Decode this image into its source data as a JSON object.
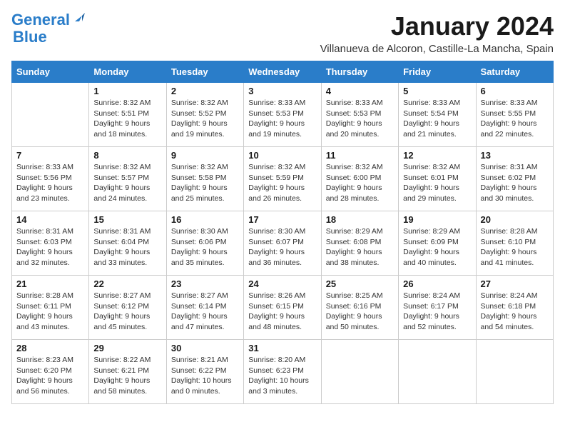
{
  "header": {
    "logo_line1": "General",
    "logo_line2": "Blue",
    "month": "January 2024",
    "location": "Villanueva de Alcoron, Castille-La Mancha, Spain"
  },
  "weekdays": [
    "Sunday",
    "Monday",
    "Tuesday",
    "Wednesday",
    "Thursday",
    "Friday",
    "Saturday"
  ],
  "weeks": [
    [
      {
        "day": "",
        "sunrise": "",
        "sunset": "",
        "daylight": ""
      },
      {
        "day": "1",
        "sunrise": "Sunrise: 8:32 AM",
        "sunset": "Sunset: 5:51 PM",
        "daylight": "Daylight: 9 hours and 18 minutes."
      },
      {
        "day": "2",
        "sunrise": "Sunrise: 8:32 AM",
        "sunset": "Sunset: 5:52 PM",
        "daylight": "Daylight: 9 hours and 19 minutes."
      },
      {
        "day": "3",
        "sunrise": "Sunrise: 8:33 AM",
        "sunset": "Sunset: 5:53 PM",
        "daylight": "Daylight: 9 hours and 19 minutes."
      },
      {
        "day": "4",
        "sunrise": "Sunrise: 8:33 AM",
        "sunset": "Sunset: 5:53 PM",
        "daylight": "Daylight: 9 hours and 20 minutes."
      },
      {
        "day": "5",
        "sunrise": "Sunrise: 8:33 AM",
        "sunset": "Sunset: 5:54 PM",
        "daylight": "Daylight: 9 hours and 21 minutes."
      },
      {
        "day": "6",
        "sunrise": "Sunrise: 8:33 AM",
        "sunset": "Sunset: 5:55 PM",
        "daylight": "Daylight: 9 hours and 22 minutes."
      }
    ],
    [
      {
        "day": "7",
        "sunrise": "Sunrise: 8:33 AM",
        "sunset": "Sunset: 5:56 PM",
        "daylight": "Daylight: 9 hours and 23 minutes."
      },
      {
        "day": "8",
        "sunrise": "Sunrise: 8:32 AM",
        "sunset": "Sunset: 5:57 PM",
        "daylight": "Daylight: 9 hours and 24 minutes."
      },
      {
        "day": "9",
        "sunrise": "Sunrise: 8:32 AM",
        "sunset": "Sunset: 5:58 PM",
        "daylight": "Daylight: 9 hours and 25 minutes."
      },
      {
        "day": "10",
        "sunrise": "Sunrise: 8:32 AM",
        "sunset": "Sunset: 5:59 PM",
        "daylight": "Daylight: 9 hours and 26 minutes."
      },
      {
        "day": "11",
        "sunrise": "Sunrise: 8:32 AM",
        "sunset": "Sunset: 6:00 PM",
        "daylight": "Daylight: 9 hours and 28 minutes."
      },
      {
        "day": "12",
        "sunrise": "Sunrise: 8:32 AM",
        "sunset": "Sunset: 6:01 PM",
        "daylight": "Daylight: 9 hours and 29 minutes."
      },
      {
        "day": "13",
        "sunrise": "Sunrise: 8:31 AM",
        "sunset": "Sunset: 6:02 PM",
        "daylight": "Daylight: 9 hours and 30 minutes."
      }
    ],
    [
      {
        "day": "14",
        "sunrise": "Sunrise: 8:31 AM",
        "sunset": "Sunset: 6:03 PM",
        "daylight": "Daylight: 9 hours and 32 minutes."
      },
      {
        "day": "15",
        "sunrise": "Sunrise: 8:31 AM",
        "sunset": "Sunset: 6:04 PM",
        "daylight": "Daylight: 9 hours and 33 minutes."
      },
      {
        "day": "16",
        "sunrise": "Sunrise: 8:30 AM",
        "sunset": "Sunset: 6:06 PM",
        "daylight": "Daylight: 9 hours and 35 minutes."
      },
      {
        "day": "17",
        "sunrise": "Sunrise: 8:30 AM",
        "sunset": "Sunset: 6:07 PM",
        "daylight": "Daylight: 9 hours and 36 minutes."
      },
      {
        "day": "18",
        "sunrise": "Sunrise: 8:29 AM",
        "sunset": "Sunset: 6:08 PM",
        "daylight": "Daylight: 9 hours and 38 minutes."
      },
      {
        "day": "19",
        "sunrise": "Sunrise: 8:29 AM",
        "sunset": "Sunset: 6:09 PM",
        "daylight": "Daylight: 9 hours and 40 minutes."
      },
      {
        "day": "20",
        "sunrise": "Sunrise: 8:28 AM",
        "sunset": "Sunset: 6:10 PM",
        "daylight": "Daylight: 9 hours and 41 minutes."
      }
    ],
    [
      {
        "day": "21",
        "sunrise": "Sunrise: 8:28 AM",
        "sunset": "Sunset: 6:11 PM",
        "daylight": "Daylight: 9 hours and 43 minutes."
      },
      {
        "day": "22",
        "sunrise": "Sunrise: 8:27 AM",
        "sunset": "Sunset: 6:12 PM",
        "daylight": "Daylight: 9 hours and 45 minutes."
      },
      {
        "day": "23",
        "sunrise": "Sunrise: 8:27 AM",
        "sunset": "Sunset: 6:14 PM",
        "daylight": "Daylight: 9 hours and 47 minutes."
      },
      {
        "day": "24",
        "sunrise": "Sunrise: 8:26 AM",
        "sunset": "Sunset: 6:15 PM",
        "daylight": "Daylight: 9 hours and 48 minutes."
      },
      {
        "day": "25",
        "sunrise": "Sunrise: 8:25 AM",
        "sunset": "Sunset: 6:16 PM",
        "daylight": "Daylight: 9 hours and 50 minutes."
      },
      {
        "day": "26",
        "sunrise": "Sunrise: 8:24 AM",
        "sunset": "Sunset: 6:17 PM",
        "daylight": "Daylight: 9 hours and 52 minutes."
      },
      {
        "day": "27",
        "sunrise": "Sunrise: 8:24 AM",
        "sunset": "Sunset: 6:18 PM",
        "daylight": "Daylight: 9 hours and 54 minutes."
      }
    ],
    [
      {
        "day": "28",
        "sunrise": "Sunrise: 8:23 AM",
        "sunset": "Sunset: 6:20 PM",
        "daylight": "Daylight: 9 hours and 56 minutes."
      },
      {
        "day": "29",
        "sunrise": "Sunrise: 8:22 AM",
        "sunset": "Sunset: 6:21 PM",
        "daylight": "Daylight: 9 hours and 58 minutes."
      },
      {
        "day": "30",
        "sunrise": "Sunrise: 8:21 AM",
        "sunset": "Sunset: 6:22 PM",
        "daylight": "Daylight: 10 hours and 0 minutes."
      },
      {
        "day": "31",
        "sunrise": "Sunrise: 8:20 AM",
        "sunset": "Sunset: 6:23 PM",
        "daylight": "Daylight: 10 hours and 3 minutes."
      },
      {
        "day": "",
        "sunrise": "",
        "sunset": "",
        "daylight": ""
      },
      {
        "day": "",
        "sunrise": "",
        "sunset": "",
        "daylight": ""
      },
      {
        "day": "",
        "sunrise": "",
        "sunset": "",
        "daylight": ""
      }
    ]
  ],
  "accent_color": "#2a7dc9"
}
